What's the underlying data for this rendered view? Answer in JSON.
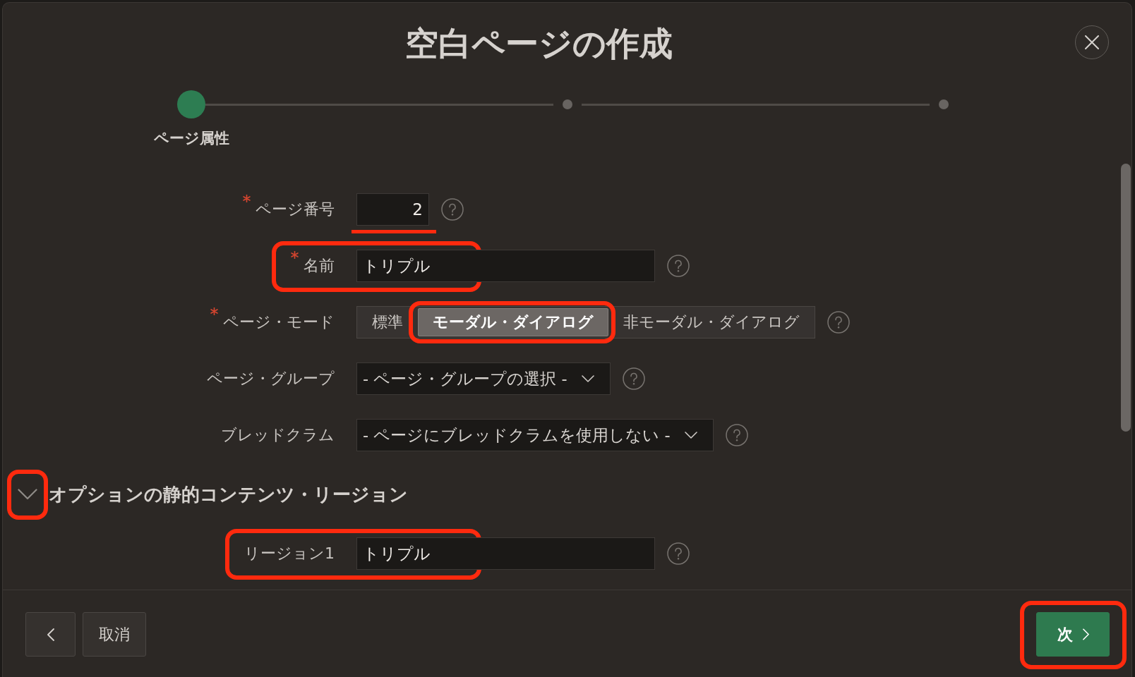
{
  "dialog": {
    "title": "空白ページの作成"
  },
  "stepper": {
    "steps": [
      {
        "label": "ページ属性",
        "current": true
      },
      {
        "current": false
      },
      {
        "current": false
      }
    ]
  },
  "form": {
    "rows": [
      {
        "kind": "number",
        "label": "ページ番号",
        "required": true,
        "value": "2",
        "highlighted": true
      },
      {
        "kind": "text",
        "label": "名前",
        "required": true,
        "value": "トリプル",
        "highlighted": true
      },
      {
        "kind": "segmented",
        "label": "ページ・モード",
        "required": true,
        "highlighted": false,
        "options": [
          {
            "label": "標準",
            "selected": false,
            "highlighted": false
          },
          {
            "label": "モーダル・ダイアログ",
            "selected": true,
            "highlighted": true
          },
          {
            "label": "非モーダル・ダイアログ",
            "selected": false,
            "highlighted": false
          }
        ]
      },
      {
        "kind": "select",
        "label": "ページ・グループ",
        "required": false,
        "value": "- ページ・グループの選択 -",
        "highlighted": false
      },
      {
        "kind": "select",
        "label": "ブレッドクラム",
        "required": false,
        "value": "- ページにブレッドクラムを使用しない -",
        "highlighted": false
      }
    ]
  },
  "section": {
    "title": "オプションの静的コンテンツ・リージョン",
    "expanded": true,
    "highlighted": true,
    "rows": [
      {
        "kind": "text",
        "label": "リージョン1",
        "required": false,
        "value": "トリプル",
        "highlighted": true
      }
    ]
  },
  "footer": {
    "buttons": [
      {
        "kind": "back",
        "highlighted": false
      },
      {
        "kind": "cancel",
        "label": "取消",
        "highlighted": false
      },
      {
        "kind": "next",
        "label": "次",
        "highlighted": true
      }
    ]
  }
}
